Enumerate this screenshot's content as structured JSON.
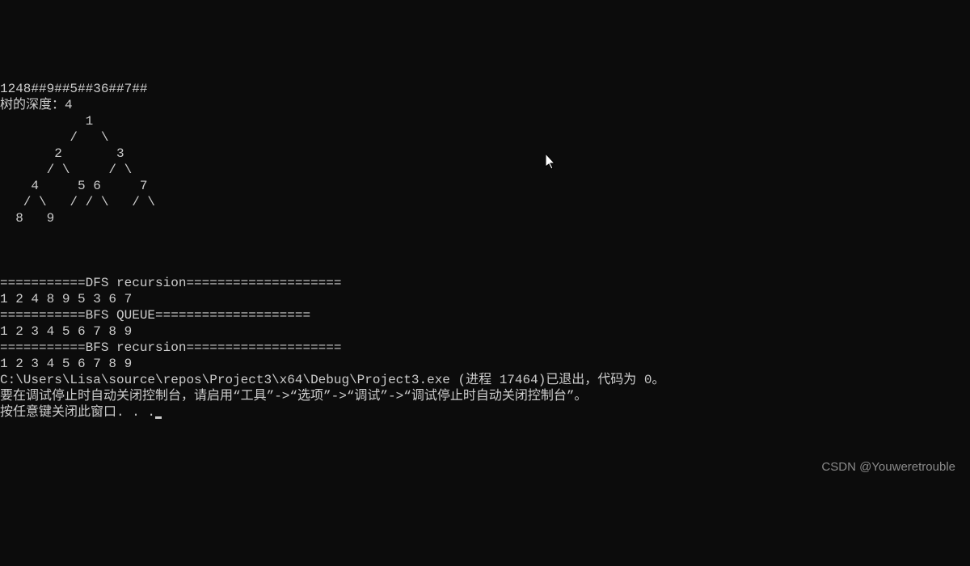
{
  "lines": {
    "input": "1248##9##5##36##7##",
    "depth": "树的深度：4",
    "tree1": "           1",
    "tree2": "         /   \\",
    "tree3": "       2       3",
    "tree4": "      / \\     / \\",
    "tree5": "    4     5 6     7",
    "tree6": "   / \\   / / \\   / \\",
    "tree7": "  8   9",
    "blank1": "",
    "blank2": "",
    "blank3": "",
    "dfs_header": "===========DFS recursion====================",
    "dfs_result": "1 2 4 8 9 5 3 6 7",
    "bfs_q_header": "===========BFS QUEUE====================",
    "bfs_q_result": "1 2 3 4 5 6 7 8 9",
    "bfs_r_header": "===========BFS recursion====================",
    "bfs_r_result": "1 2 3 4 5 6 7 8 9",
    "exit_msg": "C:\\Users\\Lisa\\source\\repos\\Project3\\x64\\Debug\\Project3.exe (进程 17464)已退出，代码为 0。",
    "hint_msg": "要在调试停止时自动关闭控制台，请启用“工具”->“选项”->“调试”->“调试停止时自动关闭控制台”。",
    "prompt": "按任意键关闭此窗口. . ."
  },
  "watermark": "CSDN @Youweretrouble"
}
